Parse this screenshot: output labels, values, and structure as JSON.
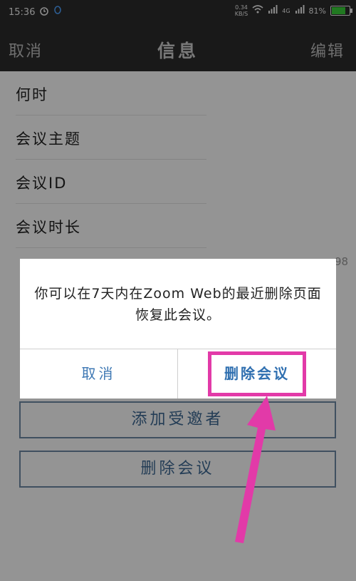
{
  "status_bar": {
    "time": "15:36",
    "net_speed_value": "0.34",
    "net_speed_unit": "KB/S",
    "sim1": "4G",
    "sim2": "4G",
    "battery_percent": "81%",
    "battery_level": 0.81
  },
  "nav": {
    "cancel_label": "取消",
    "title": "信息",
    "edit_label": "编辑"
  },
  "info_rows": [
    {
      "label": "何时"
    },
    {
      "label": "会议主题"
    },
    {
      "label": "会议ID"
    },
    {
      "label": "会议时长"
    }
  ],
  "partial_row_fragment": "98",
  "buttons": {
    "add_invitee": "添加受邀者",
    "delete_meeting": "删除会议"
  },
  "dialog": {
    "message": "你可以在7天内在Zoom Web的最近删除页面恢复此会议。",
    "cancel_label": "取消",
    "confirm_label": "删除会议"
  },
  "colors": {
    "annotation": "#e23aa8",
    "link_blue": "#3e78b4"
  }
}
